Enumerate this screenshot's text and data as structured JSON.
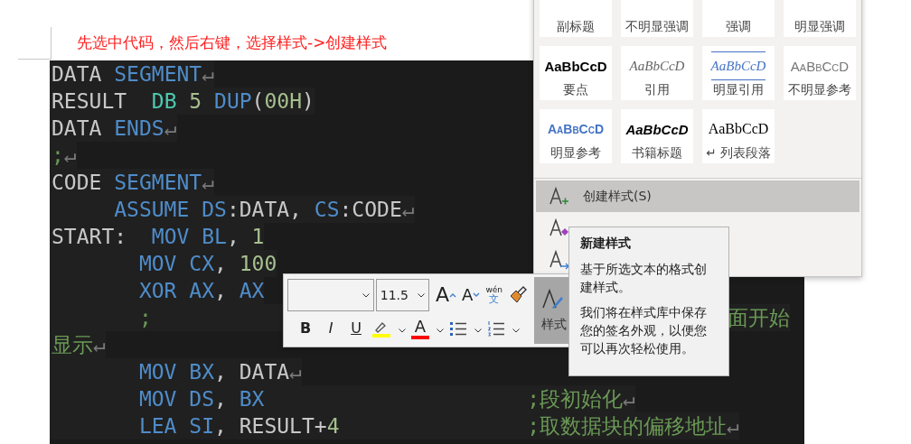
{
  "instruction": "先选中代码，然后右键，选择样式->创建样式",
  "code_lines": [
    [
      {
        "kind": "plain",
        "text": "DATA "
      },
      {
        "kind": "keyword",
        "text": "SEGMENT"
      },
      {
        "kind": "mark",
        "text": "↵"
      }
    ],
    [
      {
        "kind": "plain",
        "text": "RESULT  "
      },
      {
        "kind": "type",
        "text": "DB"
      },
      {
        "kind": "number",
        "text": " 5"
      },
      {
        "kind": "keyword",
        "text": " DUP"
      },
      {
        "kind": "plain",
        "text": "("
      },
      {
        "kind": "number",
        "text": "00H"
      },
      {
        "kind": "plain",
        "text": ")"
      }
    ],
    [
      {
        "kind": "plain",
        "text": "DATA "
      },
      {
        "kind": "keyword",
        "text": "ENDS"
      },
      {
        "kind": "mark",
        "text": "↵"
      }
    ],
    [
      {
        "kind": "comment",
        "text": ";"
      },
      {
        "kind": "mark",
        "text": "↵"
      }
    ],
    [
      {
        "kind": "plain",
        "text": "CODE "
      },
      {
        "kind": "keyword",
        "text": "SEGMENT"
      },
      {
        "kind": "mark",
        "text": "↵"
      }
    ],
    [
      {
        "kind": "keyword",
        "text": "     ASSUME DS"
      },
      {
        "kind": "plain",
        "text": ":DATA, "
      },
      {
        "kind": "keyword",
        "text": "CS"
      },
      {
        "kind": "plain",
        "text": ":CODE"
      },
      {
        "kind": "mark",
        "text": "↵"
      }
    ],
    [
      {
        "kind": "plain",
        "text": "START:  "
      },
      {
        "kind": "keyword",
        "text": "MOV BL"
      },
      {
        "kind": "plain",
        "text": ", "
      },
      {
        "kind": "number",
        "text": "1"
      }
    ],
    [
      {
        "kind": "keyword",
        "text": "       MOV CX"
      },
      {
        "kind": "plain",
        "text": ", "
      },
      {
        "kind": "number",
        "text": "100"
      }
    ],
    [
      {
        "kind": "keyword",
        "text": "       XOR AX"
      },
      {
        "kind": "plain",
        "text": ", "
      },
      {
        "kind": "keyword",
        "text": "AX"
      }
    ],
    [
      {
        "kind": "comment",
        "text": "       ;                                              面开始"
      }
    ],
    [
      {
        "kind": "comment",
        "text": "显示"
      },
      {
        "kind": "mark",
        "text": "↵"
      }
    ],
    [
      {
        "kind": "keyword",
        "text": "       MOV BX"
      },
      {
        "kind": "plain",
        "text": ", DATA"
      },
      {
        "kind": "mark",
        "text": "↵"
      }
    ],
    [
      {
        "kind": "keyword",
        "text": "       MOV DS"
      },
      {
        "kind": "plain",
        "text": ", "
      },
      {
        "kind": "keyword",
        "text": "BX"
      },
      {
        "kind": "comment",
        "text": "                     ;段初始化"
      },
      {
        "kind": "mark",
        "text": "↵"
      }
    ],
    [
      {
        "kind": "keyword",
        "text": "       LEA SI"
      },
      {
        "kind": "plain",
        "text": ", RESULT+"
      },
      {
        "kind": "number",
        "text": "4"
      },
      {
        "kind": "comment",
        "text": "               ;取数据块的偏移地址"
      },
      {
        "kind": "mark",
        "text": "↵"
      }
    ]
  ],
  "style_gallery": {
    "styles": [
      {
        "kind": "subtitle",
        "label": "副标题"
      },
      {
        "kind": "subtle_emphasis",
        "label": "不明显强调"
      },
      {
        "kind": "emphasis",
        "label": "强调"
      },
      {
        "kind": "intense_emphasis",
        "label": "明显强调"
      },
      {
        "kind": "strong",
        "sample": "AaBbCcD",
        "label": "要点"
      },
      {
        "kind": "quote",
        "sample": "AaBbCcD",
        "label": "引用"
      },
      {
        "kind": "intense_quote",
        "sample": "AaBbCcD",
        "label": "明显引用"
      },
      {
        "kind": "subtle_reference",
        "sample": "AaBbCcD",
        "label": "不明显参考"
      },
      {
        "kind": "intense_reference",
        "sample": "AaBbCcD",
        "label": "明显参考"
      },
      {
        "kind": "book_title",
        "sample": "AaBbCcD",
        "label": "书籍标题"
      },
      {
        "kind": "list_paragraph",
        "sample": "AaBbCcD",
        "label": "↵ 列表段落"
      }
    ],
    "menu_items": [
      {
        "kind": "create",
        "label": "创建样式(S)",
        "highlighted": true
      },
      {
        "kind": "clear",
        "highlighted": false
      },
      {
        "kind": "apply",
        "highlighted": false
      }
    ]
  },
  "mini_toolbar": {
    "font_size": "11.5",
    "row_1": [
      {
        "kind": "grow",
        "label": "A"
      },
      {
        "kind": "shrink",
        "label": "A"
      },
      {
        "kind": "phonetic",
        "label": "wén",
        "sublabel": "文"
      },
      {
        "kind": "painter"
      }
    ],
    "row_2": [
      {
        "kind": "bold",
        "label": "B"
      },
      {
        "kind": "italic",
        "label": "I"
      },
      {
        "kind": "underline",
        "label": "U"
      },
      {
        "kind": "highlight",
        "color": "#ffff00",
        "dropdown": true
      },
      {
        "kind": "font_color",
        "label": "A",
        "color": "#ff0000",
        "dropdown": true
      },
      {
        "kind": "bullets",
        "dropdown": true
      },
      {
        "kind": "numbering",
        "dropdown": true
      }
    ],
    "styles_button": {
      "label": "样式",
      "active": true
    }
  },
  "tooltip": {
    "title": "新建样式",
    "paragraphs": [
      "基于所选文本的格式创建样式。",
      "我们将在样式库中保存您的签名外观，以便您可以再次轻松使用。"
    ]
  }
}
